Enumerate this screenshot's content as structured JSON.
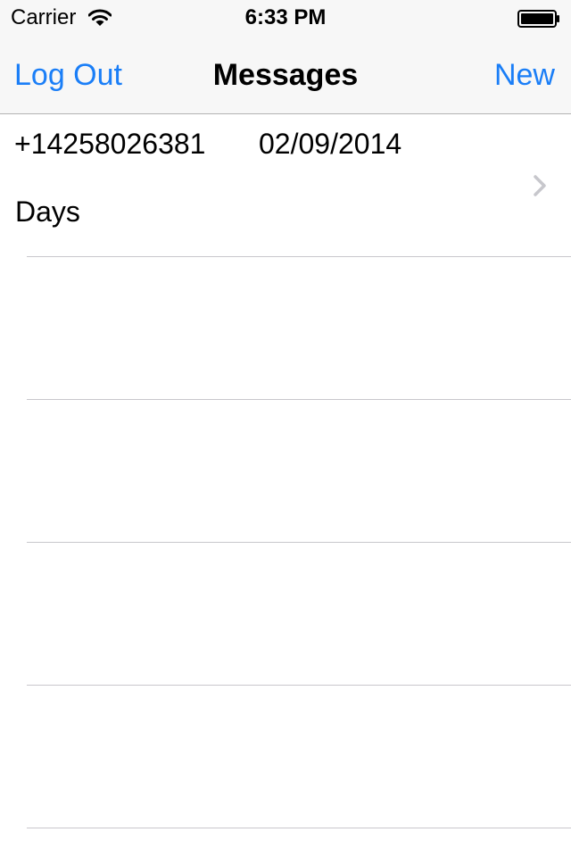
{
  "status_bar": {
    "carrier": "Carrier",
    "time": "6:33 PM",
    "icons": [
      "wifi-icon",
      "battery-icon"
    ]
  },
  "nav_bar": {
    "left_button": "Log Out",
    "title": "Messages",
    "right_button": "New"
  },
  "messages": [
    {
      "phone": "+14258026381",
      "date": "02/09/2014",
      "preview": "Days",
      "accessory": "chevron-right-icon"
    }
  ],
  "colors": {
    "tint": "#1a7ef7",
    "bar_background": "#f7f7f7",
    "separator": "#c8c7cc",
    "chevron": "#c7c7cc"
  }
}
